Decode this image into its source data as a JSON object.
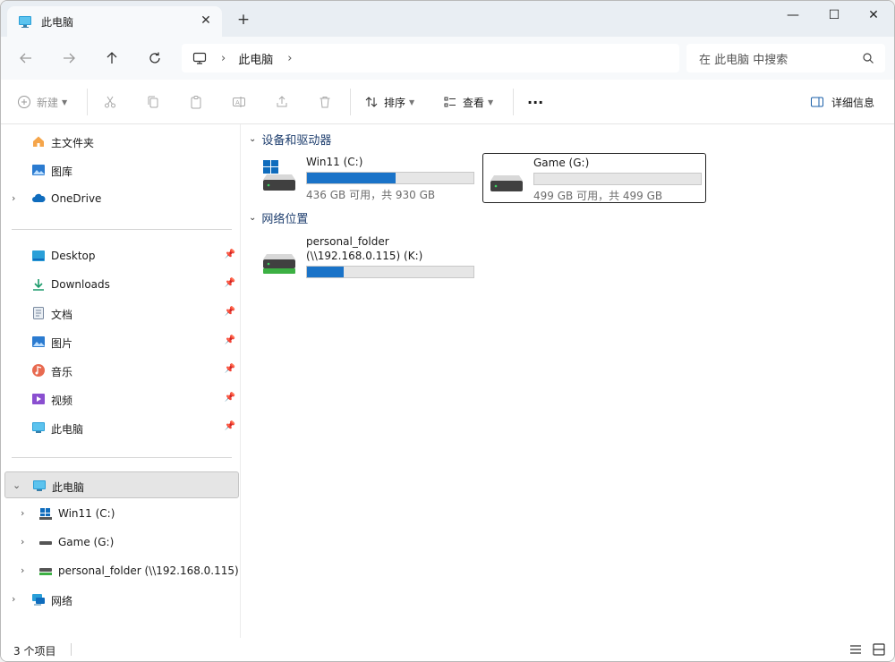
{
  "window": {
    "tab_title": "此电脑",
    "tab_close": "✕",
    "new_tab": "+",
    "controls": {
      "minimize": "—",
      "maximize": "☐",
      "close": "✕"
    }
  },
  "address": {
    "root_icon": "monitor-icon",
    "crumbs": [
      "此电脑"
    ],
    "search_placeholder": "在 此电脑 中搜索"
  },
  "toolbar": {
    "new_label": "新建",
    "sort_label": "排序",
    "view_label": "查看",
    "more_label": "···",
    "details_label": "详细信息"
  },
  "sidebar": {
    "top": [
      {
        "label": "主文件夹",
        "icon": "home-icon"
      },
      {
        "label": "图库",
        "icon": "gallery-icon"
      },
      {
        "label": "OneDrive",
        "icon": "cloud-icon"
      }
    ],
    "quick": [
      {
        "label": "Desktop",
        "icon": "desktop-icon"
      },
      {
        "label": "Downloads",
        "icon": "download-icon"
      },
      {
        "label": "文档",
        "icon": "document-icon"
      },
      {
        "label": "图片",
        "icon": "pictures-icon"
      },
      {
        "label": "音乐",
        "icon": "music-icon"
      },
      {
        "label": "视频",
        "icon": "video-icon"
      },
      {
        "label": "此电脑",
        "icon": "monitor-icon"
      }
    ],
    "tree": [
      {
        "label": "此电脑",
        "icon": "monitor-icon"
      },
      {
        "label": "Win11 (C:)",
        "icon": "windows-drive-icon"
      },
      {
        "label": "Game (G:)",
        "icon": "drive-icon"
      },
      {
        "label": "personal_folder (\\\\192.168.0.115) (",
        "icon": "network-drive-icon"
      },
      {
        "label": "网络",
        "icon": "network-icon"
      }
    ]
  },
  "content": {
    "groups": [
      {
        "title": "设备和驱动器"
      },
      {
        "title": "网络位置"
      }
    ],
    "drives": [
      {
        "name": "Win11 (C:)",
        "info": "436 GB 可用，共 930 GB",
        "used_fraction": 0.531,
        "icon": "windows-drive-icon"
      },
      {
        "name": "Game (G:)",
        "info": "499 GB 可用，共 499 GB",
        "used_fraction": 0.0,
        "icon": "drive-icon"
      },
      {
        "name": "personal_folder",
        "name2": "(\\\\192.168.0.115) (K:)",
        "used_fraction": 0.22,
        "icon": "network-drive-icon"
      }
    ]
  },
  "status": {
    "count": "3 个项目"
  },
  "colors": {
    "accent": "#1a73c8",
    "selection": "#e5e5e5",
    "titlebar": "#e9eef3"
  }
}
